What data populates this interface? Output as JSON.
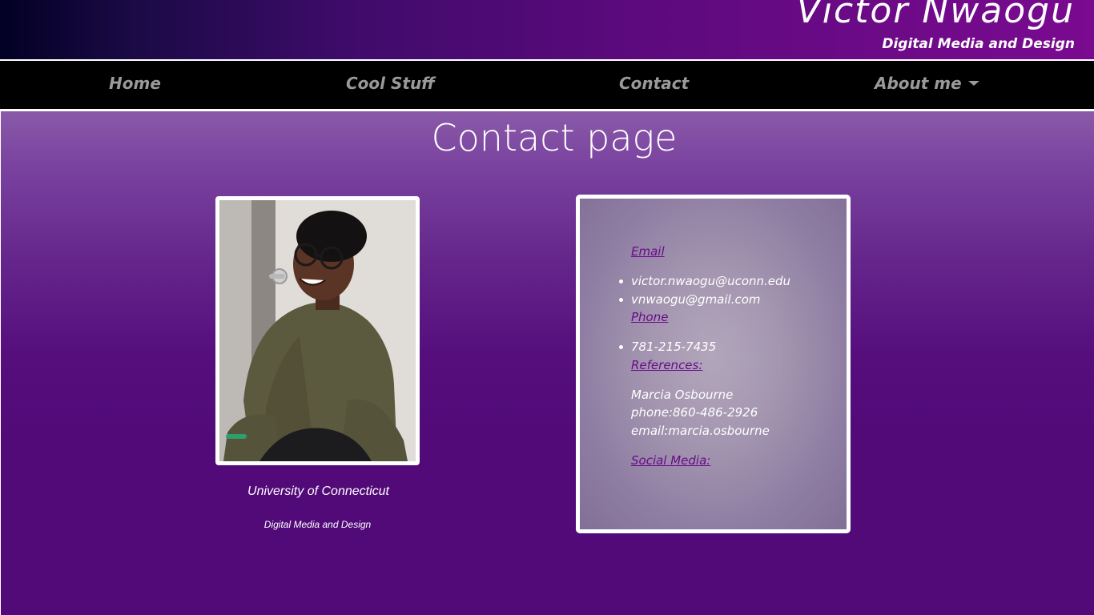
{
  "header": {
    "title": "Victor Nwaogu",
    "subtitle": "Digital Media and Design"
  },
  "nav": {
    "items": [
      {
        "label": "Home"
      },
      {
        "label": "Cool Stuff"
      },
      {
        "label": "Contact"
      },
      {
        "label": "About me",
        "has_dropdown": true
      }
    ]
  },
  "main": {
    "title": "Contact page",
    "profile": {
      "school": "University of Connecticut",
      "program": "Digital Media and Design"
    },
    "contact": {
      "email_heading": "Email",
      "emails": [
        "victor.nwaogu@uconn.edu",
        "vnwaogu@gmail.com"
      ],
      "phone_heading": "Phone",
      "phones": [
        "781-215-7435"
      ],
      "references_heading": "References:",
      "reference": {
        "name": "Marcia Osbourne",
        "phone": "phone:860-486-2926",
        "email": "email:marcia.osbourne"
      },
      "social_heading": "Social Media:"
    }
  },
  "colors": {
    "header_gradient": [
      "#020024",
      "#7a0a90"
    ],
    "nav_background": "#000000",
    "nav_text": "#9a9a9a",
    "page_gradient": [
      "#8a5aa8",
      "#510a78"
    ],
    "link": "#6a0a8a"
  }
}
